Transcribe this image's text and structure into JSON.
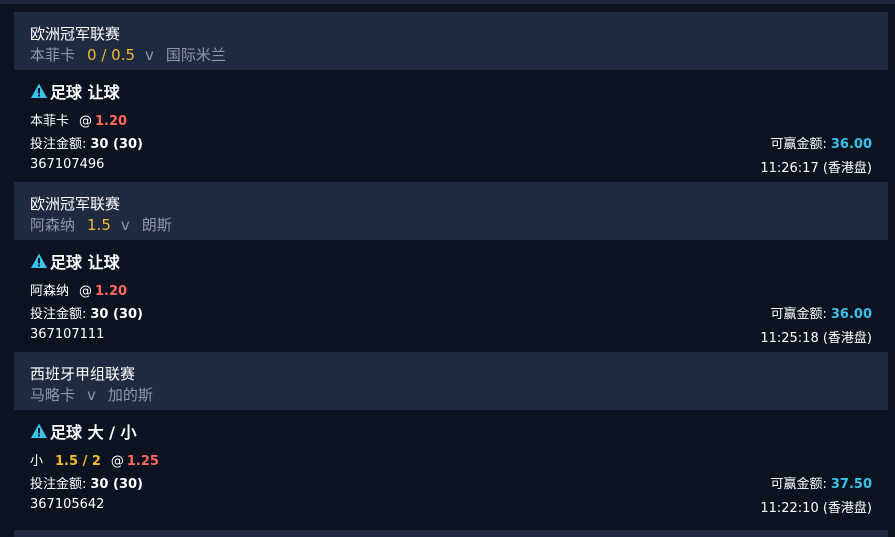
{
  "colors": {
    "background": "#0b1220",
    "header_bg": "#1e2a40",
    "handicap": "#f5b92d",
    "odds": "#ff6a5c",
    "win_value": "#39c3ea",
    "warning_icon": "#39c3ea"
  },
  "bets": [
    {
      "league": "欧洲冠军联赛",
      "home": "本菲卡",
      "handicap": "0 / 0.5",
      "vs": "v",
      "away": "国际米兰",
      "icon": "warning-icon",
      "market": "足球 让球",
      "selection": "本菲卡",
      "selection_line": "",
      "at": "@",
      "odds": "1.20",
      "stake_label": "投注金额:",
      "stake": "30 (30)",
      "win_label": "可赢金额:",
      "win": "36.00",
      "ticket_id": "367107496",
      "time": "11:26:17 (香港盘)"
    },
    {
      "league": "欧洲冠军联赛",
      "home": "阿森纳",
      "handicap": "1.5",
      "vs": "v",
      "away": "朗斯",
      "icon": "warning-icon",
      "market": "足球 让球",
      "selection": "阿森纳",
      "selection_line": "",
      "at": "@",
      "odds": "1.20",
      "stake_label": "投注金额:",
      "stake": "30 (30)",
      "win_label": "可赢金额:",
      "win": "36.00",
      "ticket_id": "367107111",
      "time": "11:25:18 (香港盘)"
    },
    {
      "league": "西班牙甲组联赛",
      "home": "马略卡",
      "handicap": "",
      "vs": "v",
      "away": "加的斯",
      "icon": "warning-icon",
      "market": "足球 大 / 小",
      "selection": "小",
      "selection_line": "1.5 / 2",
      "at": "@",
      "odds": "1.25",
      "stake_label": "投注金额:",
      "stake": "30 (30)",
      "win_label": "可赢金额:",
      "win": "37.50",
      "ticket_id": "367105642",
      "time": "11:22:10 (香港盘)"
    }
  ]
}
